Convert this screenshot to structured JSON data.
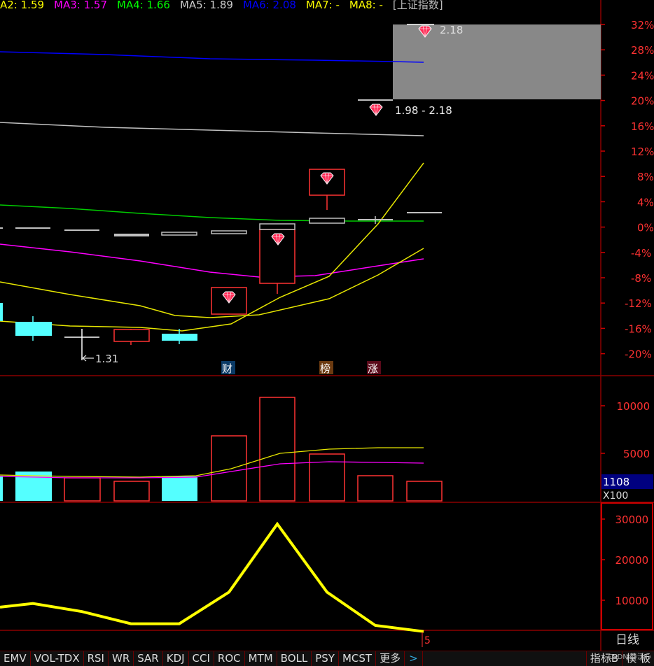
{
  "header": {
    "ma_items": [
      {
        "label": "A2: 1.59",
        "color": "#ffff00"
      },
      {
        "label": "MA3: 1.57",
        "color": "#ff00ff"
      },
      {
        "label": "MA4: 1.66",
        "color": "#00ff00"
      },
      {
        "label": "MA5: 1.89",
        "color": "#cccccc"
      },
      {
        "label": "MA6: 2.08",
        "color": "#0000ff"
      },
      {
        "label": "MA7: -",
        "color": "#ffff00"
      },
      {
        "label": "MA8: -",
        "color": "#ffff00"
      },
      {
        "label": "[上证指数]",
        "color": "#bbbbbb"
      }
    ]
  },
  "main_panel": {
    "pct_ticks": [
      "32%",
      "28%",
      "24%",
      "20%",
      "16%",
      "12%",
      "8%",
      "4%",
      "0%",
      "-4%",
      "-8%",
      "-12%",
      "-16%",
      "-20%"
    ],
    "low_label": "1.31",
    "range_label": "1.98 - 2.18",
    "high_label": "2.18",
    "event_markers": [
      "财",
      "榜",
      "涨"
    ],
    "colors": {
      "up": "#ff3232",
      "down": "#54ffff",
      "flat": "#c0c0c0",
      "ma_gray": "#c0c0c0",
      "ma_blue": "#0000ff",
      "ma_green": "#00cc00",
      "ma_magenta": "#ff00ff",
      "ma_yellow": "#ffff00"
    }
  },
  "volume_panel": {
    "ticks": [
      "10000",
      "5000"
    ],
    "current_value": "1108",
    "unit": "X100"
  },
  "indicator_panel": {
    "ticks": [
      "30000",
      "20000",
      "10000"
    ],
    "series": [
      8300,
      9200,
      7200,
      4200,
      4200,
      12000,
      28800,
      12000,
      3800,
      2300
    ]
  },
  "period_label": "日线",
  "cursor_marker": "5",
  "tabs": [
    "EMV",
    "VOL-TDX",
    "RSI",
    "WR",
    "SAR",
    "KDJ",
    "CCI",
    "ROC",
    "MTM",
    "BOLL",
    "PSY",
    "MCST",
    "更多"
  ],
  "right_tabs": [
    "指标B",
    "模 板"
  ],
  "watermark": "CSDN @沃心"
}
